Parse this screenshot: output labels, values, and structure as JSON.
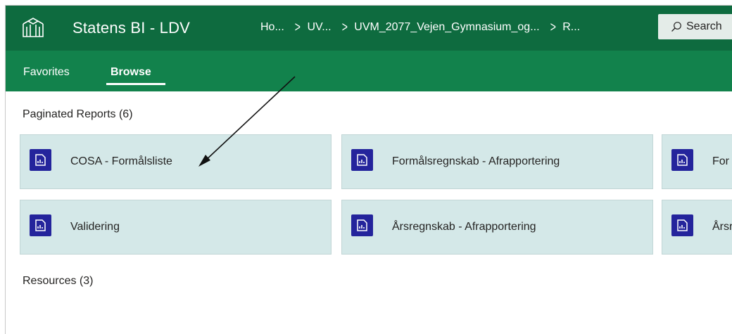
{
  "header": {
    "app_title": "Statens BI - LDV",
    "breadcrumbs": [
      "Ho...",
      "UV...",
      "UVM_2077_Vejen_Gymnasium_og...",
      "R..."
    ],
    "search_label": "Search",
    "colors": {
      "header_bg": "#0e6b3f",
      "nav_bg": "#12824c"
    }
  },
  "nav": {
    "tabs": [
      {
        "label": "Favorites",
        "active": false
      },
      {
        "label": "Browse",
        "active": true
      }
    ]
  },
  "main": {
    "paginated_title": "Paginated Reports (6)",
    "reports": [
      {
        "label": "COSA - Formålsliste",
        "icon": "paginated-report-icon"
      },
      {
        "label": "Formålsregnskab - Afrapportering",
        "icon": "paginated-report-icon"
      },
      {
        "label": "For",
        "icon": "paginated-report-icon"
      },
      {
        "label": "Validering",
        "icon": "paginated-report-icon"
      },
      {
        "label": "Årsregnskab - Afrapportering",
        "icon": "paginated-report-icon"
      },
      {
        "label": "Årsr",
        "icon": "paginated-report-icon"
      }
    ],
    "resources_title": "Resources (3)",
    "colors": {
      "card_bg": "#d4e8e8",
      "report_icon_bg": "#24249c"
    }
  }
}
